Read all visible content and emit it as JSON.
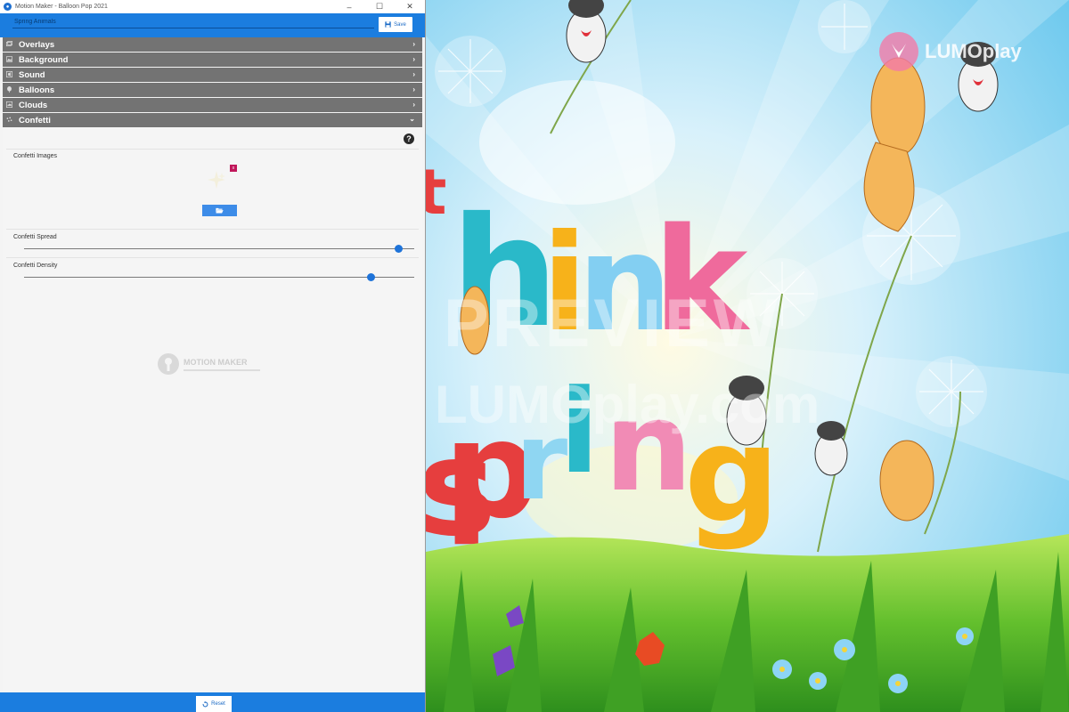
{
  "window": {
    "title": "Motion Maker - Balloon Pop 2021",
    "app_icon_glyph": "●"
  },
  "header": {
    "project_name": "Spring Animals",
    "save_label": "Save"
  },
  "sections": [
    {
      "label": "Overlays",
      "icon": "overlays-icon",
      "expanded": false
    },
    {
      "label": "Background",
      "icon": "image-icon",
      "expanded": false
    },
    {
      "label": "Sound",
      "icon": "sound-icon",
      "expanded": false
    },
    {
      "label": "Balloons",
      "icon": "balloon-icon",
      "expanded": false
    },
    {
      "label": "Clouds",
      "icon": "cloud-icon",
      "expanded": false
    },
    {
      "label": "Confetti",
      "icon": "confetti-icon",
      "expanded": true
    }
  ],
  "confetti": {
    "images_label": "Confetti Images",
    "remove_glyph": "x",
    "spread_label": "Confetti Spread",
    "spread_value": 0.96,
    "density_label": "Confetti Density",
    "density_value": 0.89
  },
  "watermark": {
    "title": "MOTION MAKER"
  },
  "footer": {
    "reset_label": "Reset"
  },
  "preview": {
    "logo_text": "LUMOplay",
    "overlay_text": "PREVIEW",
    "watermark_url": "LUMOplay.com",
    "scene_letters": [
      "t",
      "h",
      "i",
      "n",
      "k",
      "s",
      "p",
      "r",
      "i",
      "n",
      "g"
    ]
  },
  "colors": {
    "accent": "#1b7ddf",
    "section_bg": "#737373",
    "slider_knob": "#1e73d9",
    "remove_button": "#c0175a"
  }
}
